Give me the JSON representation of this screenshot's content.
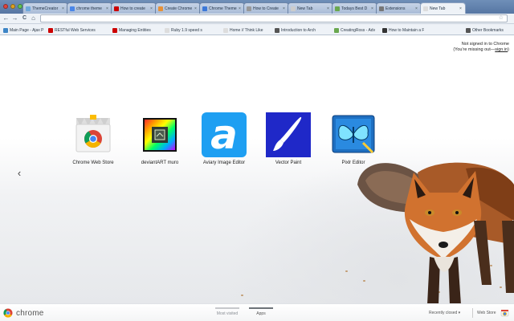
{
  "tabs": [
    {
      "label": "ThemeCreator",
      "color": "#6fa8dc"
    },
    {
      "label": "chrome theme",
      "color": "#4a86e8"
    },
    {
      "label": "How to create",
      "color": "#cc0000"
    },
    {
      "label": "Create Chrome",
      "color": "#e69138"
    },
    {
      "label": "Chrome Theme",
      "color": "#3c78d8"
    },
    {
      "label": "How to Create",
      "color": "#999999"
    },
    {
      "label": "New Tab",
      "color": "#cccccc"
    },
    {
      "label": "Todays Best D",
      "color": "#6aa84f"
    },
    {
      "label": "Extensions",
      "color": "#777777"
    },
    {
      "label": "New Tab",
      "color": "#dddddd",
      "active": true
    }
  ],
  "tab_close_glyph": "×",
  "toolbar": {
    "back": "←",
    "forward": "→",
    "reload": "C",
    "home": "⌂",
    "address_value": "",
    "star": "☆"
  },
  "bookmarks": [
    {
      "label": "Main Page - Ajax P",
      "color": "#3d85c6"
    },
    {
      "label": "RESTful Web Services",
      "color": "#cc0000"
    },
    {
      "label": "Managing Entities",
      "color": "#cc0000"
    },
    {
      "label": "Ruby 1.9 speed  s",
      "color": "#dddddd"
    },
    {
      "label": "Home // Think Like",
      "color": "#dddddd"
    },
    {
      "label": "Introduction to Arch",
      "color": "#555555"
    },
    {
      "label": "CreatingRoss - Adv",
      "color": "#6aa84f"
    },
    {
      "label": "How to Maintain a F",
      "color": "#333333"
    },
    {
      "label": "Other Bookmarks",
      "color": "#555555"
    }
  ],
  "signin": {
    "line1": "Not signed in to Chrome",
    "line2_prefix": "(You're missing out—",
    "link": "sign in",
    "line2_suffix": ")"
  },
  "nav_prev": "‹",
  "apps": [
    {
      "label": "Chrome Web Store",
      "icon": "chrome-web-store-icon"
    },
    {
      "label": "deviantART muro",
      "icon": "deviantart-muro-icon"
    },
    {
      "label": "Aviary Image Editor",
      "icon": "aviary-icon"
    },
    {
      "label": "Vector Paint",
      "icon": "vector-paint-icon"
    },
    {
      "label": "Pixlr Editor",
      "icon": "pixlr-icon"
    }
  ],
  "footer": {
    "brand": "chrome",
    "pages": [
      {
        "label": "Most visited",
        "selected": false
      },
      {
        "label": "Apps",
        "selected": true
      }
    ],
    "recently_closed": "Recently closed ▾",
    "web_store": "Web Store"
  },
  "colors": {
    "tab_strip": "#5f80ad",
    "toolbar": "#eef2f7",
    "aviary_blue": "#1e9ff2",
    "vector_paint_blue": "#1f28c8",
    "pixlr_blue": "#1e6fc1"
  }
}
